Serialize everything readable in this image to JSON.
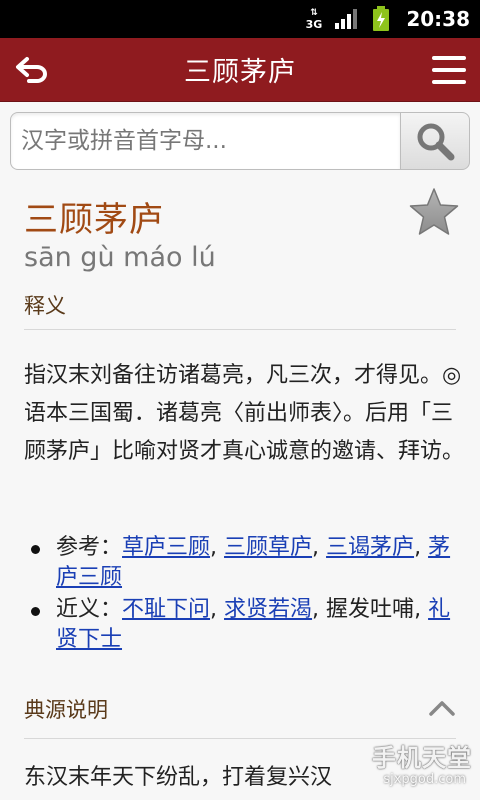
{
  "status_bar": {
    "network": "3G",
    "time": "20:38"
  },
  "header": {
    "title": "三顾茅庐"
  },
  "search": {
    "placeholder": "汉字或拼音首字母..."
  },
  "entry": {
    "word": "三顾茅庐",
    "pinyin": "sān gù máo lú",
    "definition_label": "释义",
    "definition": "指汉末刘备往访诸葛亮，凡三次，才得见。◎语本三国蜀．诸葛亮〈前出师表〉。后用「三顾茅庐」比喻对贤才真心诚意的邀请、拜访。",
    "reference": {
      "label": "参考：",
      "links": [
        "草庐三顾",
        "三顾草庐",
        "三谒茅庐",
        "茅庐三顾"
      ]
    },
    "synonym": {
      "label": "近义：",
      "links": [
        "不耻下问",
        "求贤若渴",
        "礼贤下士"
      ],
      "plain": "握发吐哺"
    },
    "origin_label": "典源说明",
    "origin_text": "东汉末年天下纷乱，打着复兴汉"
  },
  "watermark": {
    "title": "手机天堂",
    "url": "sjxpgod.com"
  },
  "colors": {
    "header": "#8f1b1f",
    "word": "#a14a14",
    "link": "#1a3fb5"
  }
}
